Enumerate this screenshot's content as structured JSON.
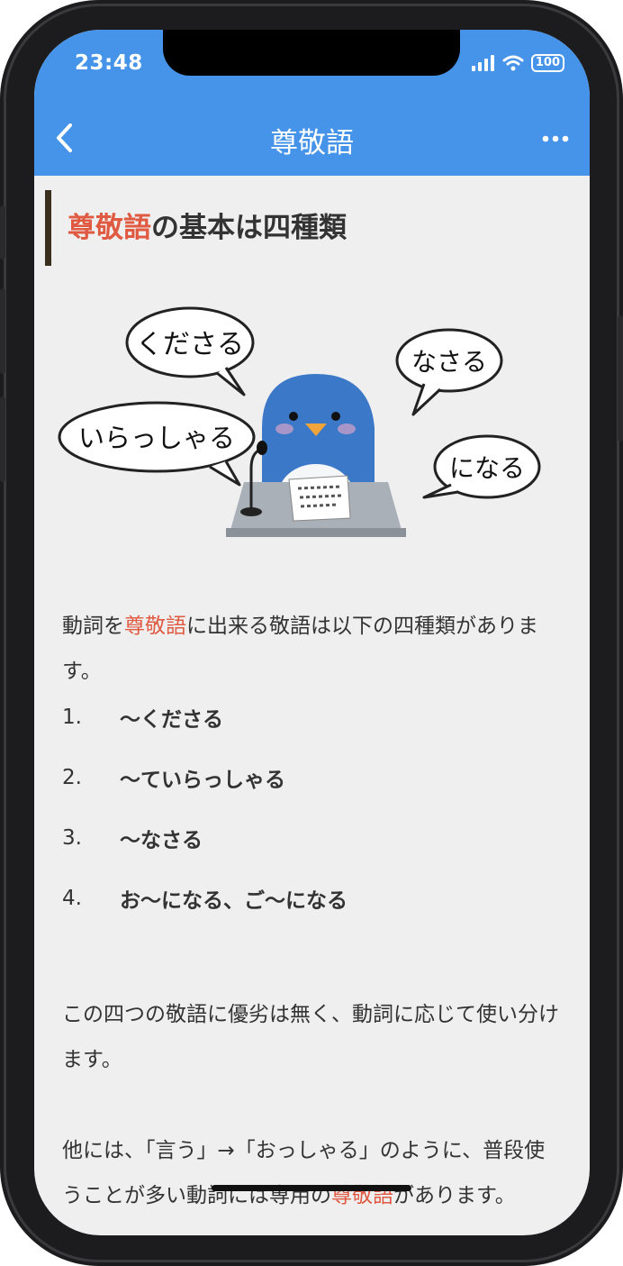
{
  "status": {
    "time": "23:48",
    "battery": "100"
  },
  "nav": {
    "title": "尊敬語"
  },
  "article": {
    "heading_red": "尊敬語",
    "heading_rest": "の基本は四種類",
    "illustration": {
      "bubbles": [
        "くださる",
        "なさる",
        "いらっしゃる",
        "になる"
      ]
    },
    "para1": {
      "t1": "動詞を",
      "red": "尊敬語",
      "t2": "に出来る敬語は以下の四種類があります。"
    },
    "list": [
      {
        "num": "1.",
        "text": "〜くださる"
      },
      {
        "num": "2.",
        "text": "〜ていらっしゃる"
      },
      {
        "num": "3.",
        "text": "〜なさる"
      },
      {
        "num": "4.",
        "text": "お〜になる、ご〜になる"
      }
    ],
    "para2": "この四つの敬語に優劣は無く、動詞に応じて使い分けます。",
    "para3": {
      "t1": "他には、「言う」→「おっしゃる」のように、普段使うことが多い動詞には専用の",
      "red": "尊敬語",
      "t2": "があります。"
    }
  }
}
